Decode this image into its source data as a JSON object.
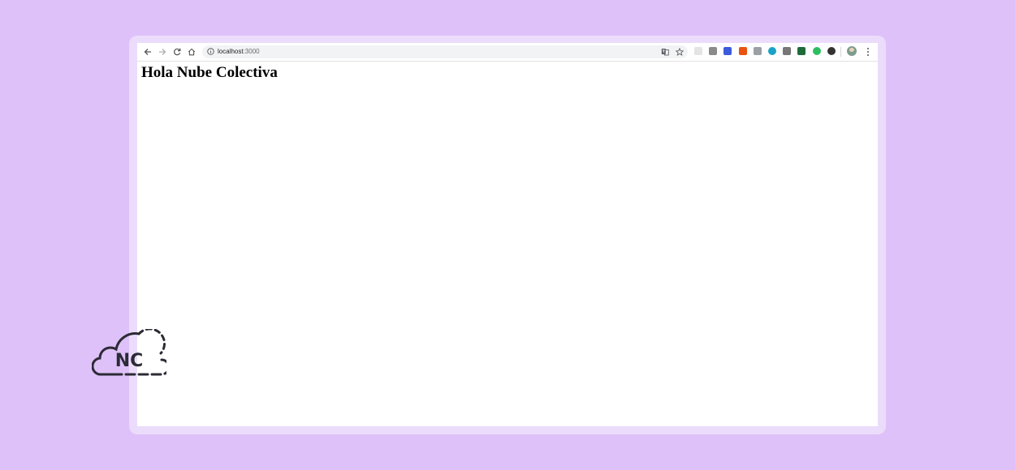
{
  "browser": {
    "url_host": "localhost",
    "url_port": ":3000",
    "icons": {
      "back": "arrow-left-icon",
      "forward": "arrow-right-icon",
      "reload": "reload-icon",
      "home": "home-icon",
      "site_info": "info-icon",
      "translate": "translate-icon",
      "bookmark": "star-icon",
      "menu": "more-vertical-icon"
    },
    "extensions": [
      {
        "name": "extension-blank-icon",
        "color": "#e4e4e4"
      },
      {
        "name": "extension-vue-devtools-icon",
        "color": "#8a8a8a"
      },
      {
        "name": "extension-blue-icon",
        "color": "#3b5bdb"
      },
      {
        "name": "extension-orange-icon",
        "color": "#e8540f"
      },
      {
        "name": "extension-notes-icon",
        "color": "#9aa0a6"
      },
      {
        "name": "extension-globe-icon",
        "color": "#1aa3c8"
      },
      {
        "name": "extension-cloud-icon",
        "color": "#777777"
      },
      {
        "name": "extension-green-dark-icon",
        "color": "#1f6b3a"
      },
      {
        "name": "extension-evernote-icon",
        "color": "#2dbe60"
      },
      {
        "name": "extension-dark-circle-icon",
        "color": "#333333"
      }
    ]
  },
  "page": {
    "heading": "Hola Nube Colectiva"
  },
  "logo": {
    "text": "NC",
    "name": "nube-colectiva-logo"
  },
  "colors": {
    "background": "#dfc1f9",
    "frame": "#ecdcfb",
    "omnibox": "#f1f3f4",
    "logo_stroke": "#2b2b35"
  }
}
